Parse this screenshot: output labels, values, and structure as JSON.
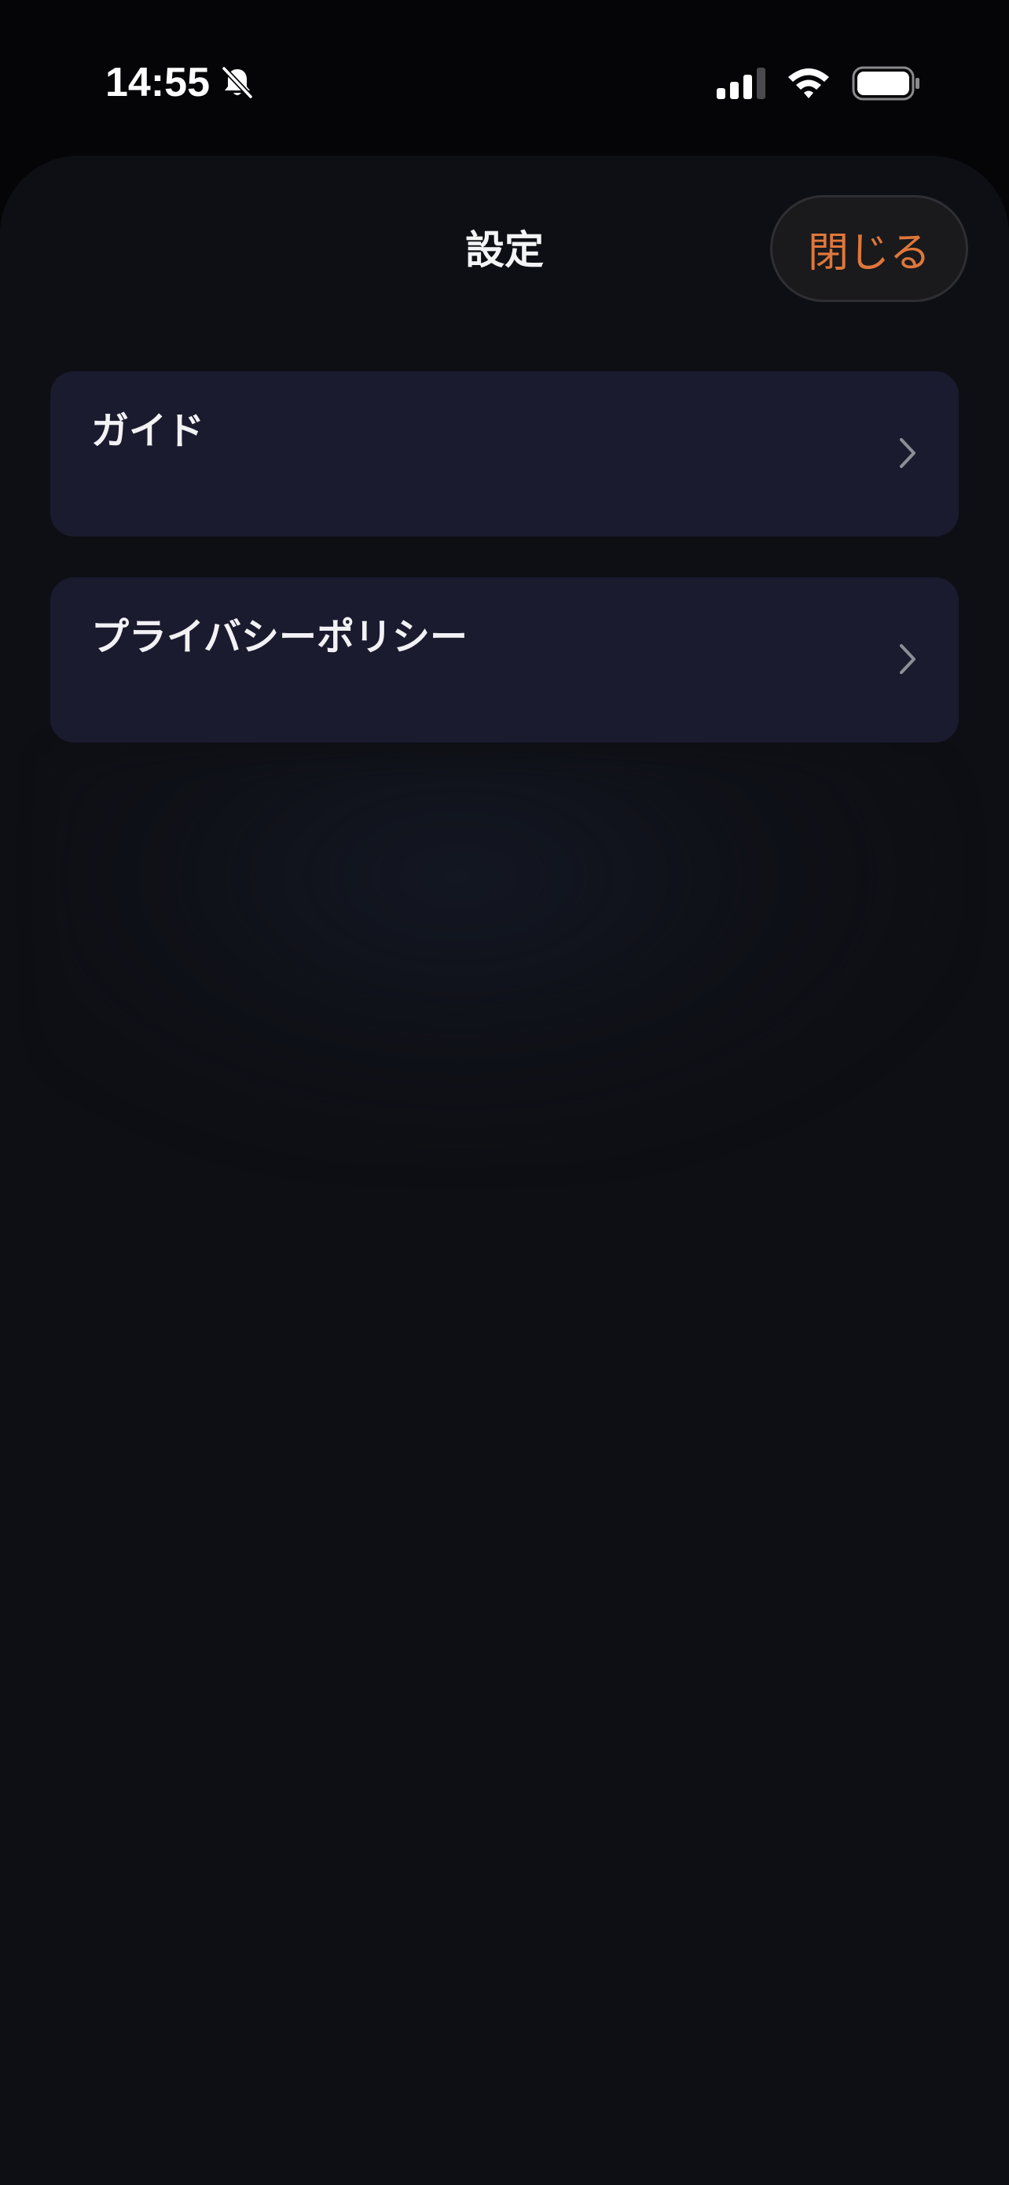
{
  "status_bar": {
    "time": "14:55",
    "silent_icon": "bell-slash-icon",
    "signal_icon": "cellular-signal-icon",
    "wifi_icon": "wifi-icon",
    "battery_icon": "battery-icon"
  },
  "sheet": {
    "title": "設定",
    "close_label": "閉じる",
    "items": [
      {
        "label": "ガイド",
        "icon": "chevron-right-icon"
      },
      {
        "label": "プライバシーポリシー",
        "icon": "chevron-right-icon"
      }
    ]
  },
  "colors": {
    "background": "#050507",
    "sheet_background": "#0e0f14",
    "card_background": "#1a1b2e",
    "accent": "#e0773a"
  }
}
